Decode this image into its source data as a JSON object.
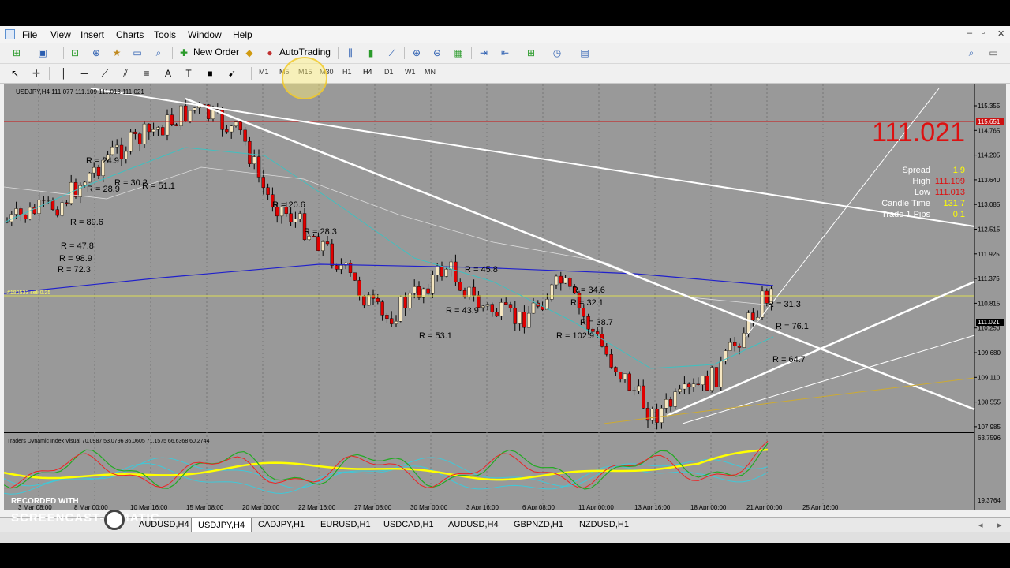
{
  "menu": {
    "items": [
      "File",
      "View",
      "Insert",
      "Charts",
      "Tools",
      "Window",
      "Help"
    ]
  },
  "toolbar": {
    "new_order": "New Order",
    "auto_trading": "AutoTrading",
    "timeframes": [
      "M1",
      "M5",
      "M15",
      "M30",
      "H1",
      "H4",
      "D1",
      "W1",
      "MN"
    ],
    "active_timeframe": "H4"
  },
  "chart": {
    "header": "USDJPY,H4  111.077 111.109 111.013 111.021",
    "order_label": "#180533 sell 0.25",
    "price_axis": [
      "115.355",
      "114.765",
      "114.205",
      "113.640",
      "113.085",
      "112.515",
      "111.925",
      "111.375",
      "110.815",
      "110.250",
      "109.680",
      "109.110",
      "108.555",
      "107.985"
    ],
    "current_price_tag": "111.021",
    "top_red_tag": "115.651",
    "time_axis": [
      "3 Mar 08:00",
      "8 Mar 00:00",
      "10 Mar 16:00",
      "15 Mar 08:00",
      "20 Mar 00:00",
      "22 Mar 16:00",
      "27 Mar 08:00",
      "30 Mar 00:00",
      "3 Apr 16:00",
      "6 Apr 08:00",
      "11 Apr 00:00",
      "13 Apr 16:00",
      "18 Apr 00:00",
      "21 Apr 00:00",
      "25 Apr 16:00"
    ],
    "r_labels": [
      "R = 89.6",
      "R = 72.3",
      "R = 98.9",
      "R = 47.8",
      "R = 24.9",
      "R = 30.2",
      "R = 51.1",
      "R = 28.9",
      "R = 45.8",
      "R = 34.6",
      "R = 38.7",
      "R = 31.3",
      "R = 76.1",
      "R = 53.1",
      "R = 32.1",
      "R = 43.9",
      "R = 102.9",
      "R = 64.7",
      "R = 28.3",
      "R = 20.6"
    ],
    "info": {
      "price": "111.021",
      "rows": [
        {
          "label": "Spread",
          "value": "1.9"
        },
        {
          "label": "High",
          "value": "111.109"
        },
        {
          "label": "Low",
          "value": "111.013"
        },
        {
          "label": "Candle Time",
          "value": "131:7"
        },
        {
          "label": "Trade 1 Pips",
          "value": "0.1"
        }
      ]
    },
    "indicator": {
      "header": "Traders Dynamic Index Visual 70.0987 53.0796 36.0605 71.1575 66.6368 60.2744",
      "axis_top": "63.7596",
      "axis_bottom": "19.3764"
    }
  },
  "tabs": {
    "items": [
      "AUDUSD,H4",
      "USDJPY,H4",
      "CADJPY,H1",
      "EURUSD,H1",
      "USDCAD,H1",
      "AUDUSD,H4",
      "GBPNZD,H1",
      "NZDUSD,H1"
    ],
    "active": "USDJPY,H4"
  },
  "watermark": {
    "line1": "RECORDED WITH",
    "line2": "SCREENCAST-O-MATIC"
  },
  "colors": {
    "chart_bg": "#999999",
    "bull": "#f5e6c0",
    "bear": "#e00000",
    "ma_blue": "#2020cc",
    "ma_teal": "#40c0c0",
    "info_red": "#dd1111",
    "info_yellow": "#ffff00"
  }
}
